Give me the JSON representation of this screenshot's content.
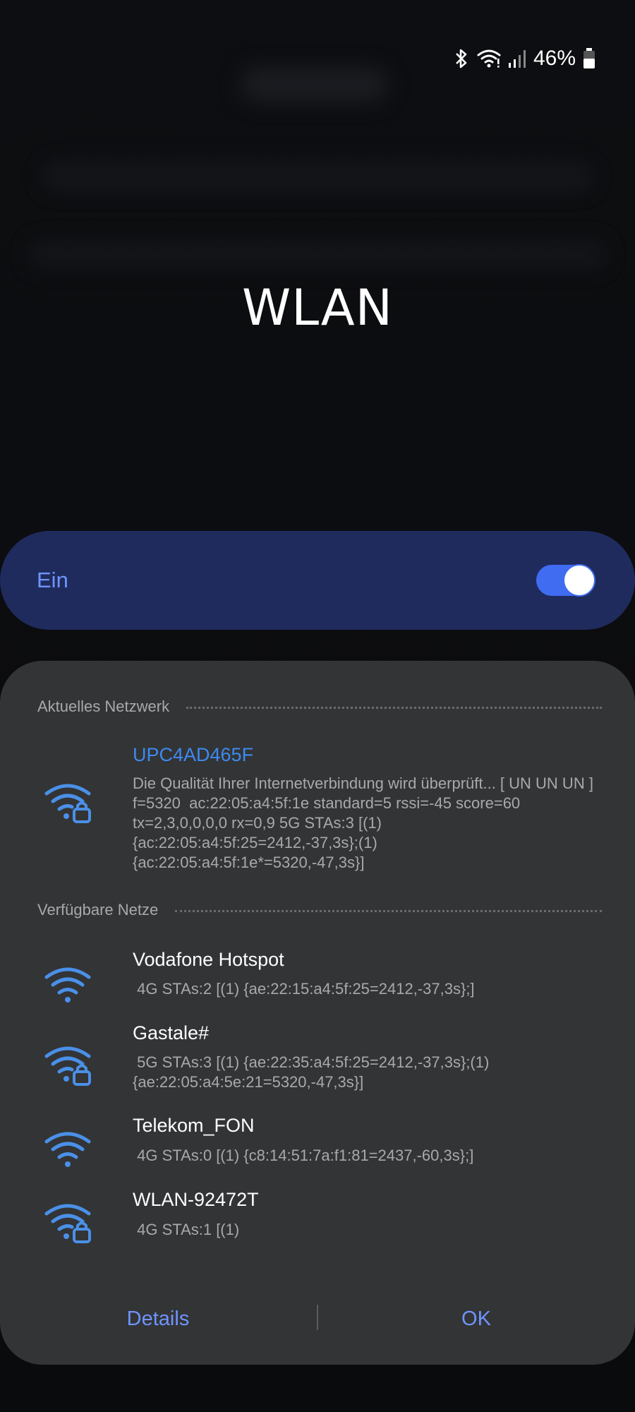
{
  "status_bar": {
    "battery_percent": "46%",
    "icons": [
      "bluetooth-icon",
      "wifi-status-icon",
      "cell-signal-icon",
      "battery-icon"
    ]
  },
  "title": "WLAN",
  "toggle": {
    "label": "Ein",
    "on": true
  },
  "sections": {
    "current": "Aktuelles Netzwerk",
    "available": "Verfügbare Netze"
  },
  "current_network": {
    "name": "UPC4AD465F",
    "detail": "Die Qualität Ihrer Internetverbindung wird überprüft... [ UN UN UN ]  f=5320  ac:22:05:a4:5f:1e standard=5 rssi=-45 score=60 tx=2,3,0,0,0,0 rx=0,9 5G STAs:3 [(1) {ac:22:05:a4:5f:25=2412,-37,3s};(1) {ac:22:05:a4:5f:1e*=5320,-47,3s}]",
    "secured": true
  },
  "available_networks": [
    {
      "name": "Vodafone Hotspot",
      "detail": " 4G STAs:2 [(1) {ae:22:15:a4:5f:25=2412,-37,3s};]",
      "secured": false
    },
    {
      "name": "Gastale#",
      "detail": " 5G STAs:3 [(1) {ae:22:35:a4:5f:25=2412,-37,3s};(1) {ae:22:05:a4:5e:21=5320,-47,3s}]",
      "secured": true
    },
    {
      "name": "Telekom_FON",
      "detail": " 4G STAs:0 [(1) {c8:14:51:7a:f1:81=2437,-60,3s};]",
      "secured": false
    },
    {
      "name": "WLAN-92472T",
      "detail": " 4G STAs:1 [(1)",
      "secured": true
    }
  ],
  "buttons": {
    "details": "Details",
    "ok": "OK"
  },
  "colors": {
    "accent": "#6f94ff",
    "current_network": "#3d8aef",
    "toggle_bg": "#1f2b5c",
    "dialog_bg": "#333436",
    "wifi_icon": "#4a90e8"
  }
}
